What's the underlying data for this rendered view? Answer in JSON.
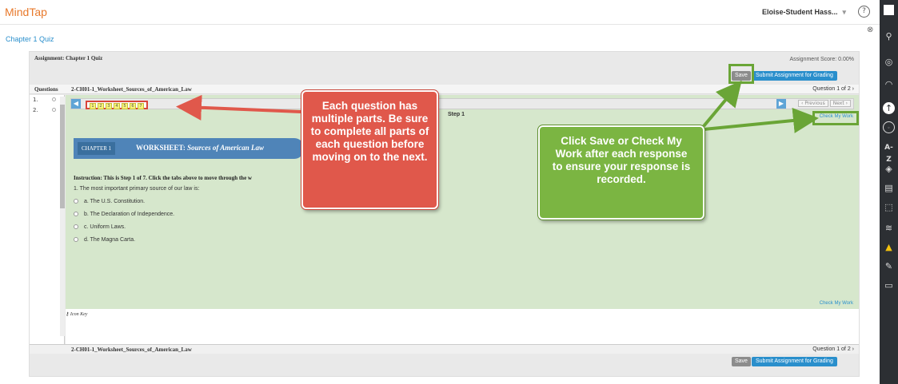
{
  "app": {
    "name": "MindTap",
    "user": "Eloise-Student Hass...",
    "help_glyph": "?",
    "close_glyph": "⊗"
  },
  "quiz_title": "Chapter 1 Quiz",
  "assignment": {
    "title": "Assignment: Chapter 1 Quiz",
    "score": "Assignment Score: 0.00%",
    "save_label": "Save",
    "submit_label": "Submit Assignment for Grading"
  },
  "question_header": {
    "list_title": "Questions",
    "name": "2-CH01-1_Worksheet_Sources_of_American_Law",
    "counter": "Question 1 of 2 ›"
  },
  "questions": [
    {
      "num": "1."
    },
    {
      "num": "2."
    }
  ],
  "steps": {
    "tabs": [
      "1",
      "2",
      "3",
      "4",
      "5",
      "6",
      "7"
    ],
    "label": "Step 1",
    "prev": "‹ Previous",
    "next": "Next ›"
  },
  "worksheet": {
    "chapter": "CHAPTER 1",
    "title_prefix": "WORKSHEET:",
    "title_italic": "Sources of American Law"
  },
  "instruction": "Instruction: This is Step 1 of 7. Click the tabs above to move through the w",
  "question_text": "1.  The most important primary source of our law is:",
  "options": [
    "a. The U.S. Constitution.",
    "b. The Declaration of Independence.",
    "c. Uniform Laws.",
    "d. The Magna Carta."
  ],
  "check_my_work": "Check My Work",
  "icon_key": "Icon Key",
  "callouts": {
    "red": "Each question has multiple parts. Be sure to complete all parts of each question before moving on to the next.",
    "green": "Click Save or Check My Work after each response to ensure your response is recorded."
  },
  "colors": {
    "brand": "#e8792b",
    "accent": "#2a8fcc",
    "panel": "#d6e7cc",
    "callout_red": "#e0584b",
    "callout_green": "#7bb542"
  },
  "sidebar_icons": [
    "apps-icon",
    "search-icon",
    "account-icon",
    "rss-icon",
    "upload-icon",
    "badge-icon",
    "az-icon",
    "diamond-icon",
    "notebook-icon",
    "flashcards-icon",
    "audio-icon",
    "google-drive-icon",
    "notes-icon",
    "cards-icon"
  ]
}
